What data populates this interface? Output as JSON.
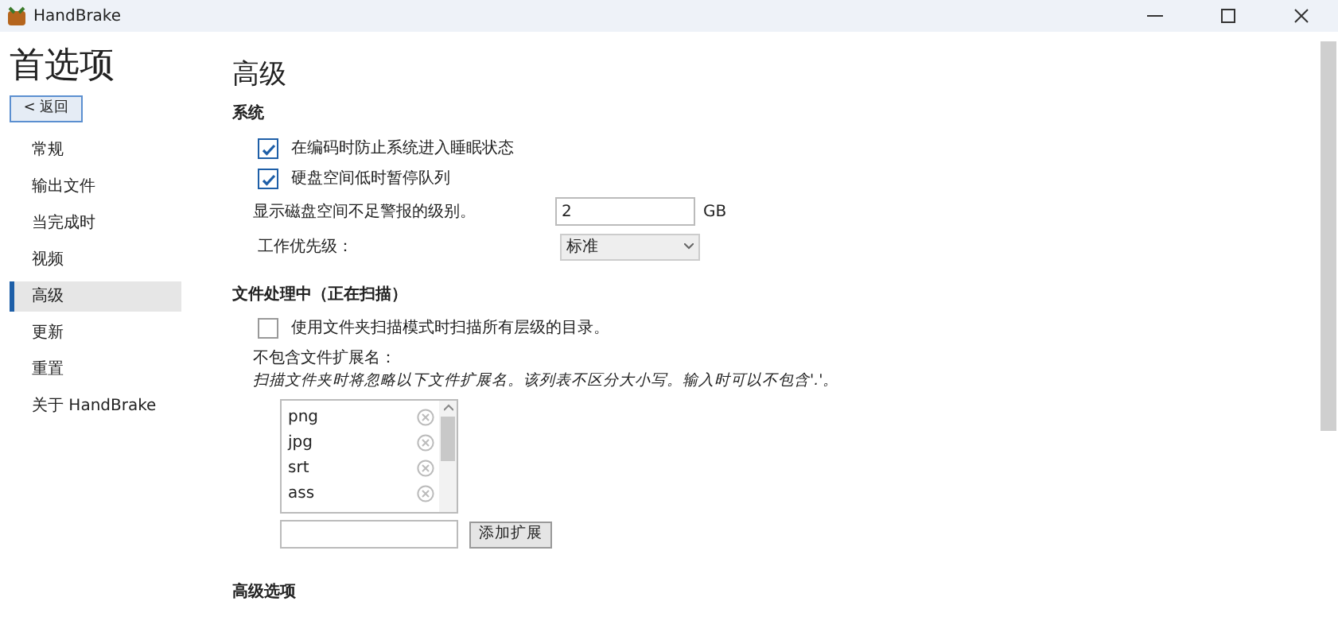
{
  "window": {
    "title": "HandBrake"
  },
  "sidebar": {
    "title": "首选项",
    "back_button": "< 返回",
    "items": [
      {
        "label": "常规",
        "selected": false
      },
      {
        "label": "输出文件",
        "selected": false
      },
      {
        "label": "当完成时",
        "selected": false
      },
      {
        "label": "视频",
        "selected": false
      },
      {
        "label": "高级",
        "selected": true
      },
      {
        "label": "更新",
        "selected": false
      },
      {
        "label": "重置",
        "selected": false
      },
      {
        "label": "关于 HandBrake",
        "selected": false
      }
    ]
  },
  "page_title": "高级",
  "system": {
    "heading": "系统",
    "checkboxes": [
      {
        "label": "在编码时防止系统进入睡眠状态",
        "checked": true
      },
      {
        "label": "硬盘空间低时暂停队列",
        "checked": true
      }
    ],
    "disk_warning": {
      "label": "显示磁盘空间不足警报的级别。",
      "value": "2",
      "unit": "GB"
    },
    "priority": {
      "label": "工作优先级：",
      "value": "标准"
    }
  },
  "file_processing": {
    "heading": "文件处理中（正在扫描）",
    "checkbox": {
      "label": "使用文件夹扫描模式时扫描所有层级的目录。",
      "checked": false
    },
    "exclude_label": "不包含文件扩展名：",
    "exclude_hint": "扫描文件夹时将忽略以下文件扩展名。该列表不区分大小写。输入时可以不包含'.'。",
    "extensions": [
      "png",
      "jpg",
      "srt",
      "ass"
    ],
    "add_button": "添加扩展"
  },
  "advanced_options": {
    "heading": "高级选项"
  }
}
